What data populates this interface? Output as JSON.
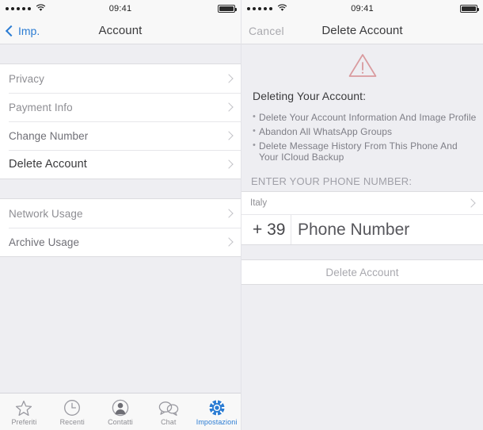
{
  "status_bar": {
    "time": "09:41",
    "signal_dots": 5,
    "wifi_icon": "wifi-icon",
    "battery_icon": "battery-icon"
  },
  "left_screen": {
    "nav": {
      "back_label": "Imp.",
      "title": "Account",
      "back_icon": "chevron-left-icon"
    },
    "group_one": [
      {
        "label": "Privacy",
        "style": "light"
      },
      {
        "label": "Payment Info",
        "style": "light"
      },
      {
        "label": "Change Number",
        "style": "mid"
      },
      {
        "label": "Delete Account",
        "style": "dark"
      }
    ],
    "group_two": [
      {
        "label": "Network Usage",
        "style": "light"
      },
      {
        "label": "Archive Usage",
        "style": "mid"
      }
    ],
    "tabs": [
      {
        "label": "Preferiti",
        "icon": "star-icon",
        "active": false
      },
      {
        "label": "Recenti",
        "icon": "clock-icon",
        "active": false
      },
      {
        "label": "Contatti",
        "icon": "person-icon",
        "active": false
      },
      {
        "label": "Chat",
        "icon": "chat-bubbles-icon",
        "active": false
      },
      {
        "label": "Impostazioni",
        "icon": "gear-icon",
        "active": true
      }
    ]
  },
  "right_screen": {
    "nav": {
      "cancel_label": "Cancel",
      "title": "Delete Account"
    },
    "warning_icon": "warning-triangle-icon",
    "heading": "Deleting Your Account:",
    "bullets": [
      "Delete Your Account Information And Image Profile",
      "Abandon All WhatsApp Groups",
      "Delete Message History From This Phone And Your ICloud Backup"
    ],
    "section_header": "ENTER YOUR PHONE NUMBER:",
    "country": {
      "value": "Italy",
      "disclosure_icon": "chevron-right-icon"
    },
    "phone": {
      "prefix": "+ 39",
      "placeholder": "Phone Number",
      "value": ""
    },
    "delete_button_label": "Delete Account"
  },
  "colors": {
    "accent_blue": "#2b7cd3",
    "warning_red": "#d99a9e",
    "page_background": "#eeeef2",
    "row_background": "#ffffff"
  }
}
